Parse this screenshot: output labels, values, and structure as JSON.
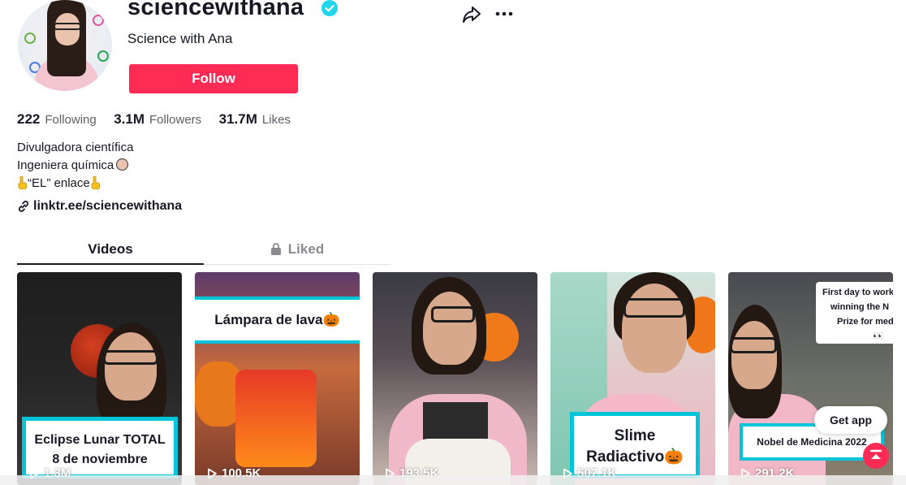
{
  "profile": {
    "username": "sciencewithana",
    "nickname": "Science with Ana",
    "follow_label": "Follow"
  },
  "stats": [
    {
      "value": "222",
      "label": "Following"
    },
    {
      "value": "3.1M",
      "label": "Followers"
    },
    {
      "value": "31.7M",
      "label": "Likes"
    }
  ],
  "bio": {
    "line1": "Divulgadora científica",
    "line2": "Ingeniera química",
    "line3": "“EL” enlace",
    "link": "linktr.ee/sciencewithana"
  },
  "tabs": {
    "videos": "Videos",
    "liked": "Liked"
  },
  "videos": [
    {
      "caption_line1": "Eclipse Lunar TOTAL",
      "caption_line2": "8 de noviembre",
      "views": "1.3M"
    },
    {
      "caption": "Lámpara de lava🎃",
      "views": "100.5K"
    },
    {
      "views": "193.5K"
    },
    {
      "caption_line1": "Slime",
      "caption_line2": "Radiactivo🎃",
      "views": "507.1K"
    },
    {
      "caption": "Nobel de Medicina 2022",
      "overlay_line1": "First day to work",
      "overlay_line2": "winning the N",
      "overlay_line3": "Prize for medic",
      "overlay_line4": "👀",
      "views": "291.2K"
    }
  ],
  "floating": {
    "get_app": "Get app"
  },
  "colors": {
    "accent": "#fe2c55",
    "verified": "#20d5ec",
    "caption_border": "#00c4d8",
    "text": "#161823",
    "muted": "#8a8b91"
  },
  "icons": [
    "verified-badge-icon",
    "share-icon",
    "more-icon",
    "scientist-emoji-icon",
    "pointing-down-emoji-icon",
    "link-icon",
    "lock-icon",
    "play-icon",
    "back-to-top-icon"
  ]
}
